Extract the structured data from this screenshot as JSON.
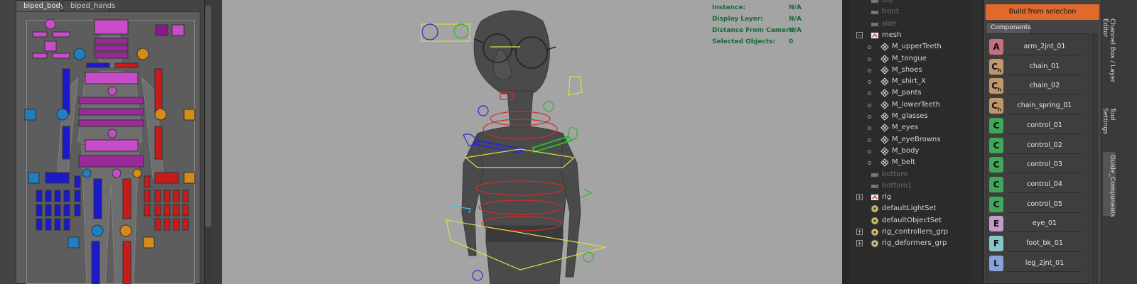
{
  "picker": {
    "tabs": [
      "biped_body",
      "biped_hands"
    ]
  },
  "hud": [
    {
      "label": "Instance:",
      "value": "N/A"
    },
    {
      "label": "Display Layer:",
      "value": "N/A"
    },
    {
      "label": "Distance From Camera:",
      "value": "N/A"
    },
    {
      "label": "Selected Objects:",
      "value": "0"
    }
  ],
  "outliner": {
    "rows": [
      {
        "label": "top",
        "indent": 1,
        "icon": "camera-icon",
        "dim": true,
        "expander": ""
      },
      {
        "label": "front",
        "indent": 1,
        "icon": "camera-icon",
        "dim": true,
        "expander": ""
      },
      {
        "label": "side",
        "indent": 1,
        "icon": "camera-icon",
        "dim": true,
        "expander": ""
      },
      {
        "label": "mesh",
        "indent": 1,
        "icon": "group-icon",
        "dim": false,
        "expander": "−"
      },
      {
        "label": "M_upperTeeth",
        "indent": 2,
        "icon": "mesh-icon",
        "dim": false,
        "expander": ""
      },
      {
        "label": "M_tongue",
        "indent": 2,
        "icon": "mesh-icon",
        "dim": false,
        "expander": ""
      },
      {
        "label": "M_shoes",
        "indent": 2,
        "icon": "mesh-icon",
        "dim": false,
        "expander": ""
      },
      {
        "label": "M_shirt_X",
        "indent": 2,
        "icon": "mesh-icon",
        "dim": false,
        "expander": ""
      },
      {
        "label": "M_pants",
        "indent": 2,
        "icon": "mesh-icon",
        "dim": false,
        "expander": ""
      },
      {
        "label": "M_lowerTeeth",
        "indent": 2,
        "icon": "mesh-icon",
        "dim": false,
        "expander": ""
      },
      {
        "label": "M_glasses",
        "indent": 2,
        "icon": "mesh-icon",
        "dim": false,
        "expander": ""
      },
      {
        "label": "M_eyes",
        "indent": 2,
        "icon": "mesh-icon",
        "dim": false,
        "expander": ""
      },
      {
        "label": "M_eyeBrowns",
        "indent": 2,
        "icon": "mesh-icon",
        "dim": false,
        "expander": ""
      },
      {
        "label": "M_body",
        "indent": 2,
        "icon": "mesh-icon",
        "dim": false,
        "expander": ""
      },
      {
        "label": "M_belt",
        "indent": 2,
        "icon": "mesh-icon",
        "dim": false,
        "expander": ""
      },
      {
        "label": "bottom",
        "indent": 1,
        "icon": "camera-icon",
        "dim": true,
        "expander": ""
      },
      {
        "label": "bottom1",
        "indent": 1,
        "icon": "camera-icon",
        "dim": true,
        "expander": ""
      },
      {
        "label": "rig",
        "indent": 1,
        "icon": "group-icon",
        "dim": false,
        "expander": "+"
      },
      {
        "label": "defaultLightSet",
        "indent": 1,
        "icon": "set-icon",
        "dim": false,
        "expander": ""
      },
      {
        "label": "defaultObjectSet",
        "indent": 1,
        "icon": "set-icon",
        "dim": false,
        "expander": ""
      },
      {
        "label": "rig_controllers_grp",
        "indent": 1,
        "icon": "set-icon",
        "dim": false,
        "expander": "+"
      },
      {
        "label": "rig_deformers_grp",
        "indent": 1,
        "icon": "set-icon",
        "dim": false,
        "expander": "+"
      }
    ]
  },
  "components_panel": {
    "build_button": "Build from selection",
    "tab": "Components",
    "items": [
      {
        "letter": "A",
        "sub": "",
        "name": "arm_2jnt_01",
        "color": "#c46f82"
      },
      {
        "letter": "C",
        "sub": "h",
        "name": "chain_01",
        "color": "#c0966a"
      },
      {
        "letter": "C",
        "sub": "h",
        "name": "chain_02",
        "color": "#c0966a"
      },
      {
        "letter": "C",
        "sub": "h",
        "name": "chain_spring_01",
        "color": "#c0966a"
      },
      {
        "letter": "C",
        "sub": "",
        "name": "control_01",
        "color": "#3fa65a"
      },
      {
        "letter": "C",
        "sub": "",
        "name": "control_02",
        "color": "#3fa65a"
      },
      {
        "letter": "C",
        "sub": "",
        "name": "control_03",
        "color": "#3fa65a"
      },
      {
        "letter": "C",
        "sub": "",
        "name": "control_04",
        "color": "#3fa65a"
      },
      {
        "letter": "C",
        "sub": "",
        "name": "control_05",
        "color": "#3fa65a"
      },
      {
        "letter": "E",
        "sub": "",
        "name": "eye_01",
        "color": "#c59acb"
      },
      {
        "letter": "F",
        "sub": "",
        "name": "foot_bk_01",
        "color": "#86c6c9"
      },
      {
        "letter": "L",
        "sub": "",
        "name": "leg_2jnt_01",
        "color": "#8aa0d8"
      }
    ]
  },
  "side_tabs": [
    "Channel Box / Layer Editor",
    "Tool Settings",
    "Guide_Components"
  ],
  "colors": {
    "accent": "#e06a2b",
    "hud": "#1a6a3a"
  }
}
